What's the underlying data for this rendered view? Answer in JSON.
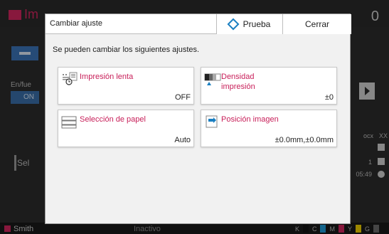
{
  "background": {
    "app_title": "Im",
    "counter": "0",
    "side_label": "En/fue",
    "side_toggle": "ON",
    "select_label": "Sel",
    "right_texts": [
      "ocx",
      "XX",
      "1",
      "05:49"
    ],
    "user": "Smith",
    "status": "Inactivo",
    "ink_labels": [
      "K",
      "C",
      "M",
      "Y",
      "G"
    ]
  },
  "dialog": {
    "title": "Cambiar ajuste",
    "test_button": "Prueba",
    "close_button": "Cerrar",
    "description": "Se pueden cambiar los siguientes ajustes.",
    "cards": [
      {
        "label": "Impresión lenta",
        "value": "OFF"
      },
      {
        "label": "Densidad impresión",
        "value": "±0"
      },
      {
        "label": "Selección de papel",
        "value": "Auto"
      },
      {
        "label": "Posición imagen",
        "value": "±0.0mm,±0.0mm"
      }
    ]
  },
  "colors": {
    "accent": "#c8205a",
    "info_icon": "#1a7fc1",
    "ink_k": "#111111",
    "ink_c": "#1e9ad6",
    "ink_m": "#d2255f",
    "ink_y": "#f0d000",
    "ink_g": "#6a6a6a"
  }
}
